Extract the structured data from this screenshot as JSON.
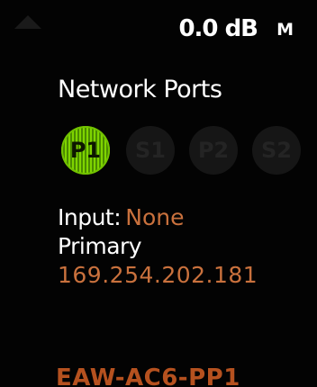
{
  "header": {
    "level_text": "0.0 dB",
    "mode_badge": "M",
    "corner_icon": "network-icon"
  },
  "page": {
    "title": "Network Ports"
  },
  "ports": [
    {
      "label": "P1",
      "active": true
    },
    {
      "label": "S1",
      "active": false
    },
    {
      "label": "P2",
      "active": false
    },
    {
      "label": "S2",
      "active": false
    }
  ],
  "details": {
    "input_label": "Input:",
    "input_value": "None",
    "primary_label": "Primary",
    "ip_address": "169.254.202.181"
  },
  "device": {
    "name": "EAW-AC6-PP1"
  },
  "colors": {
    "background": "#030303",
    "active_port": "#7fd400",
    "value_text": "#c9713d",
    "device_name": "#b5511f"
  }
}
